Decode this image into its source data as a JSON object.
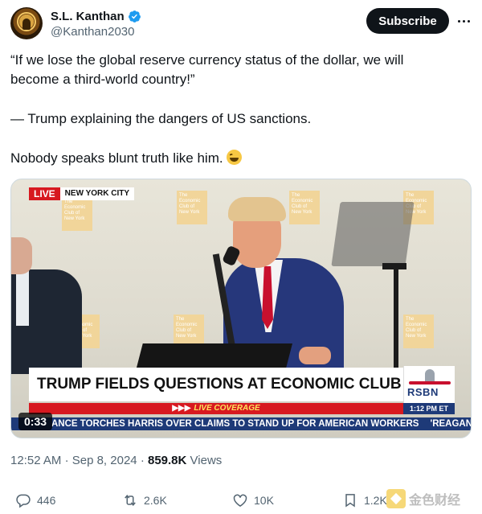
{
  "author": {
    "name": "S.L. Kanthan",
    "handle": "@Kanthan2030",
    "verified_icon": "verified-badge-icon",
    "subscribe_label": "Subscribe",
    "more_icon": "more-options-icon"
  },
  "tweet": {
    "line1": "“If we lose the global reserve currency status of the dollar, we will",
    "line2": "become a third-world country!”",
    "line3": "— Trump explaining the dangers of US sanctions.",
    "line4": "Nobody speaks blunt truth like him.",
    "emoji": "grinning-squinting-face-emoji"
  },
  "video": {
    "live_label": "LIVE",
    "location": "NEW YORK CITY",
    "backdrop_sign": "The Economic Club of New York",
    "headline": "TRUMP FIELDS QUESTIONS AT ECONOMIC CLUB OF NY",
    "network": "RSBN",
    "live_coverage": "LIVE COVERAGE",
    "live_coverage_arrows": "▶▶▶",
    "clock": "1:12 PM ET",
    "ticker_1": "ANCE TORCHES HARRIS OVER CLAIMS TO STAND UP FOR AMERICAN WORKERS",
    "ticker_2": "'REAGAN' B",
    "timestamp": "0:33"
  },
  "meta": {
    "time": "12:52 AM",
    "separator1": "·",
    "date": "Sep 8, 2024",
    "separator2": "·",
    "views_count": "859.8K",
    "views_label": "Views"
  },
  "actions": {
    "replies": "446",
    "reposts": "2.6K",
    "likes": "10K",
    "bookmarks": "1.2K"
  },
  "watermark": {
    "text": "金色财经"
  },
  "colors": {
    "text": "#0f1419",
    "secondary": "#536471",
    "verified": "#1d9bf0",
    "live_red": "#d71920",
    "network_blue": "#1e3a78"
  }
}
